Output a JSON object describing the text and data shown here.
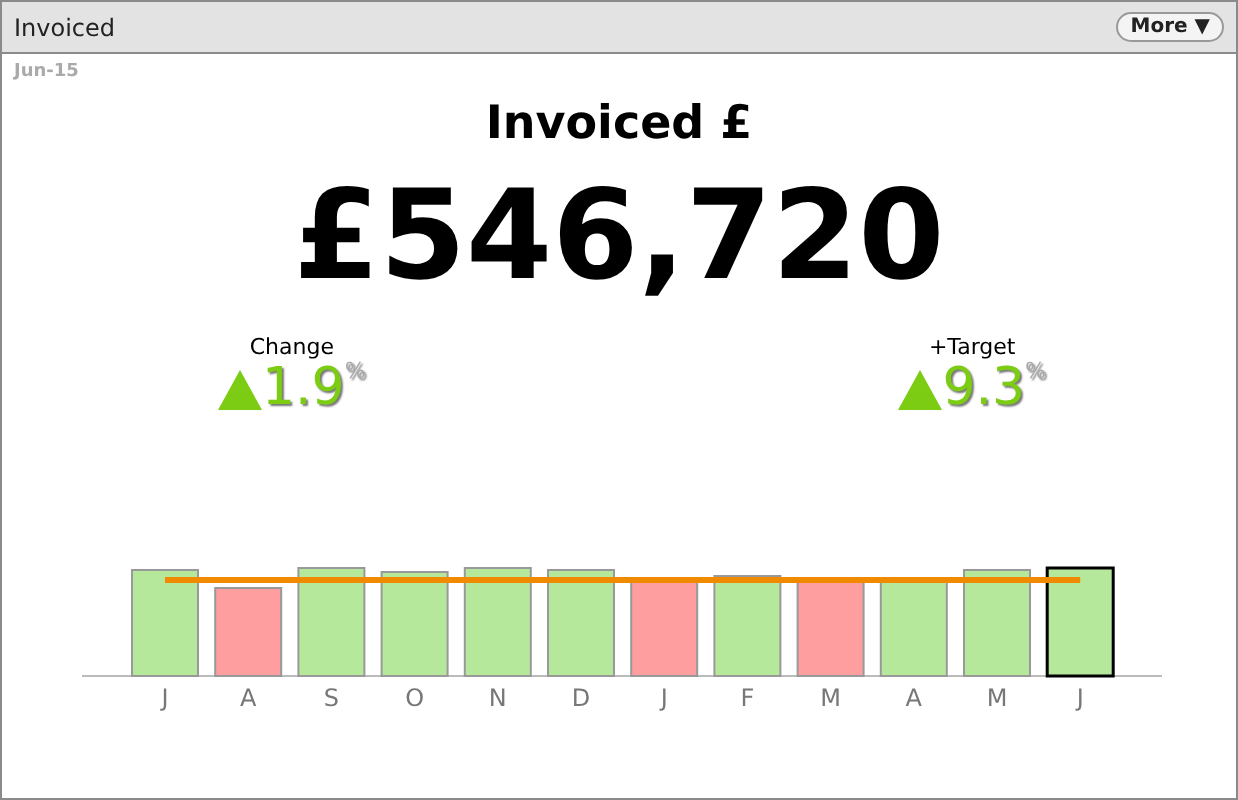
{
  "window": {
    "title": "Invoiced",
    "menu_button": "More ▼"
  },
  "period": "Jun-15",
  "headline": {
    "title": "Invoiced £",
    "value": "£546,720"
  },
  "indicators": [
    {
      "label": "Change",
      "value": "1.9",
      "unit": "%",
      "rising": true
    },
    {
      "label": "+Target",
      "value": "9.3",
      "unit": "%",
      "rising": true
    }
  ],
  "months": [
    {
      "label": "J",
      "color": "#b6e89c",
      "selected": false
    },
    {
      "label": "A",
      "color": "#ff9e9e",
      "selected": false
    },
    {
      "label": "S",
      "color": "#b6e89c",
      "selected": false
    },
    {
      "label": "O",
      "color": "#b6e89c",
      "selected": false
    },
    {
      "label": "N",
      "color": "#b6e89c",
      "selected": false
    },
    {
      "label": "D",
      "color": "#b6e89c",
      "selected": false
    },
    {
      "label": "J",
      "color": "#ff9e9e",
      "selected": false
    },
    {
      "label": "F",
      "color": "#b6e89c",
      "selected": false
    },
    {
      "label": "M",
      "color": "#ff9e9e",
      "selected": false
    },
    {
      "label": "A",
      "color": "#b6e89c",
      "selected": false
    },
    {
      "label": "M",
      "color": "#b6e89c",
      "selected": false
    },
    {
      "label": "J",
      "color": "#b6e89c",
      "selected": true
    }
  ]
}
